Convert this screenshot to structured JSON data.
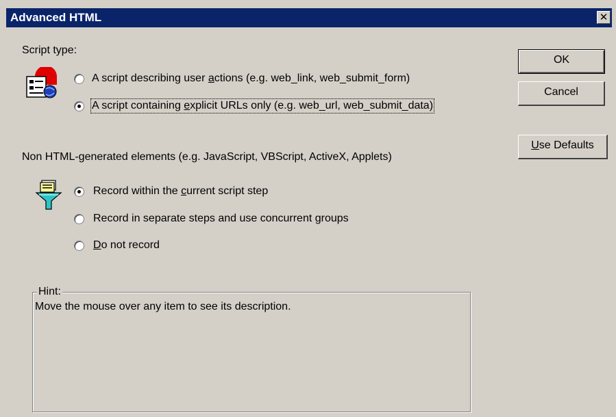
{
  "window": {
    "title": "Advanced HTML",
    "close_glyph": "✕"
  },
  "script_type": {
    "label": "Script type:",
    "options": [
      {
        "pre": "A script describing user ",
        "u": "a",
        "post": "ctions (e.g. web_link, web_submit_form)",
        "checked": false
      },
      {
        "pre": "A script containing ",
        "u": "e",
        "post": "xplicit URLs only (e.g. web_url, web_submit_data)",
        "checked": true
      }
    ]
  },
  "non_html": {
    "label": "Non HTML-generated elements (e.g. JavaScript, VBScript, ActiveX, Applets)",
    "options": [
      {
        "pre": "Record within the ",
        "u": "c",
        "post": "urrent script step",
        "checked": true
      },
      {
        "pre": "Record in separate steps and use concurrent groups",
        "u": "",
        "post": "",
        "checked": false
      },
      {
        "pre": "",
        "u": "D",
        "post": "o not record",
        "checked": false
      }
    ]
  },
  "buttons": {
    "ok": "OK",
    "cancel": "Cancel",
    "use_defaults_u": "U",
    "use_defaults_rest": "se Defaults"
  },
  "hint": {
    "legend": "Hint:",
    "text": "Move the mouse over any item to see its description."
  },
  "icons": {
    "script_type_icon": "script-page-icon",
    "non_html_icon": "filter-funnel-icon"
  },
  "colors": {
    "titlebar": "#0a246a",
    "dialog_bg": "#d4d0c8"
  }
}
